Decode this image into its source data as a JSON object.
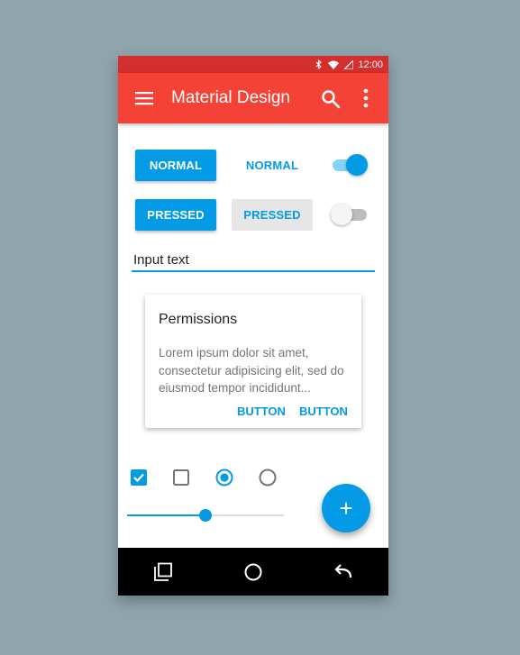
{
  "status_bar": {
    "time": "12:00",
    "icons": [
      "bluetooth-icon",
      "wifi-icon",
      "signal-icon"
    ]
  },
  "app_bar": {
    "title": "Material Design",
    "icons": [
      "menu-icon",
      "search-icon",
      "more-vert-icon"
    ]
  },
  "buttons": {
    "row1": {
      "raised_label": "NORMAL",
      "flat_label": "NORMAL"
    },
    "row2": {
      "raised_label": "PRESSED",
      "flat_label": "PRESSED"
    }
  },
  "switches": [
    {
      "state": "on"
    },
    {
      "state": "off"
    }
  ],
  "input": {
    "value": "Input text"
  },
  "card": {
    "title": "Permissions",
    "body": "Lorem ipsum dolor sit amet, consectetur adipisicing elit, sed do eiusmod tempor incididunt...",
    "buttons": [
      "BUTTON",
      "BUTTON"
    ]
  },
  "controls": {
    "checkbox_checked": true,
    "checkbox_unchecked": false,
    "radio_selected": true,
    "radio_unselected": false
  },
  "slider": {
    "value": 0.5
  },
  "fab": {
    "label": "+"
  },
  "nav_bar": {
    "icons": [
      "recents-icon",
      "home-icon",
      "back-icon"
    ]
  },
  "colors": {
    "primary": "#f44336",
    "primary_dark": "#d32f2f",
    "accent": "#039be5",
    "background": "#90a4ae"
  }
}
